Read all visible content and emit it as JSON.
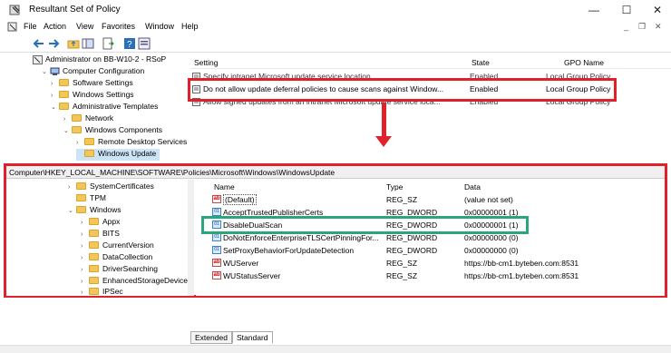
{
  "window": {
    "title": "Resultant Set of Policy",
    "minimize": "—",
    "maximize": "☐",
    "close": "✕",
    "restore_min": "_",
    "restore": "❐",
    "restore_close": "✕"
  },
  "menu": [
    "File",
    "Action",
    "View",
    "Favorites",
    "Window",
    "Help"
  ],
  "tree": [
    {
      "label": "Administrator on BB-W10-2 - RSoP",
      "indent": 0,
      "caret": ""
    },
    {
      "label": "Computer Configuration",
      "indent": 1,
      "caret": "v"
    },
    {
      "label": "Software Settings",
      "indent": 2,
      "caret": ">"
    },
    {
      "label": "Windows Settings",
      "indent": 2,
      "caret": ">"
    },
    {
      "label": "Administrative Templates",
      "indent": 2,
      "caret": "v"
    },
    {
      "label": "Network",
      "indent": 3,
      "caret": ">"
    },
    {
      "label": "Windows Components",
      "indent": 3,
      "caret": "v"
    },
    {
      "label": "Remote Desktop Services",
      "indent": 4,
      "caret": ">"
    },
    {
      "label": "Windows Update",
      "indent": 4,
      "caret": ""
    }
  ],
  "policy_header": {
    "setting": "Setting",
    "state": "State",
    "gpo": "GPO Name"
  },
  "policies": [
    {
      "setting": "Specify intranet Microsoft update service location",
      "state": "Enabled",
      "gpo": "Local Group Policy"
    },
    {
      "setting": "Do not allow update deferral policies to cause scans against Window...",
      "state": "Enabled",
      "gpo": "Local Group Policy"
    },
    {
      "setting": "Allow signed updates from an intranet Microsoft update service loca...",
      "state": "Enabled",
      "gpo": "Local Group Policy"
    }
  ],
  "registry": {
    "path": "Computer\\HKEY_LOCAL_MACHINE\\SOFTWARE\\Policies\\Microsoft\\Windows\\WindowsUpdate",
    "tree": [
      {
        "label": "SystemCertificates",
        "indent": 0,
        "caret": ">"
      },
      {
        "label": "TPM",
        "indent": 0,
        "caret": ""
      },
      {
        "label": "Windows",
        "indent": 0,
        "caret": "v"
      },
      {
        "label": "Appx",
        "indent": 1,
        "caret": ">"
      },
      {
        "label": "BITS",
        "indent": 1,
        "caret": ">"
      },
      {
        "label": "CurrentVersion",
        "indent": 1,
        "caret": ">"
      },
      {
        "label": "DataCollection",
        "indent": 1,
        "caret": ">"
      },
      {
        "label": "DriverSearching",
        "indent": 1,
        "caret": ">"
      },
      {
        "label": "EnhancedStorageDevices",
        "indent": 1,
        "caret": ">"
      },
      {
        "label": "IPSec",
        "indent": 1,
        "caret": ">"
      }
    ],
    "header": {
      "name": "Name",
      "type": "Type",
      "data": "Data"
    },
    "values": [
      {
        "icon": "ab",
        "name": "(Default)",
        "type": "REG_SZ",
        "data": "(value not set)"
      },
      {
        "icon": "dw",
        "name": "AcceptTrustedPublisherCerts",
        "type": "REG_DWORD",
        "data": "0x00000001 (1)"
      },
      {
        "icon": "dw",
        "name": "DisableDualScan",
        "type": "REG_DWORD",
        "data": "0x00000001 (1)"
      },
      {
        "icon": "dw",
        "name": "DoNotEnforceEnterpriseTLSCertPinningFor...",
        "type": "REG_DWORD",
        "data": "0x00000000 (0)"
      },
      {
        "icon": "dw",
        "name": "SetProxyBehaviorForUpdateDetection",
        "type": "REG_DWORD",
        "data": "0x00000000 (0)"
      },
      {
        "icon": "ab",
        "name": "WUServer",
        "type": "REG_SZ",
        "data": "https://bb-cm1.byteben.com:8531"
      },
      {
        "icon": "ab",
        "name": "WUStatusServer",
        "type": "REG_SZ",
        "data": "https://bb-cm1.byteben.com:8531"
      }
    ]
  },
  "tabs": [
    "Extended",
    "Standard"
  ],
  "colors": {
    "highlight_red": "#e0202a",
    "highlight_green": "#2aa77a",
    "folder": "#f3c659"
  }
}
